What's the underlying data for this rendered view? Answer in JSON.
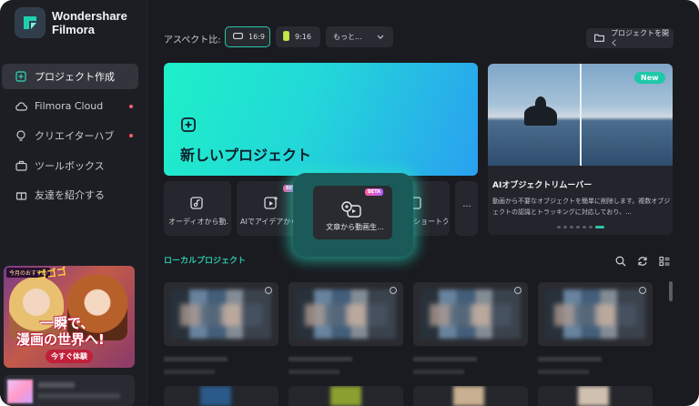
{
  "app": {
    "brand_line1": "Wondershare",
    "brand_line2": "Filmora"
  },
  "sidebar": {
    "items": [
      {
        "label": "プロジェクト作成",
        "icon": "plus-square-icon",
        "active": true,
        "dot": false
      },
      {
        "label": "Filmora Cloud",
        "icon": "cloud-icon",
        "active": false,
        "dot": true
      },
      {
        "label": "クリエイターハブ",
        "icon": "lightbulb-icon",
        "active": false,
        "dot": true
      },
      {
        "label": "ツールボックス",
        "icon": "toolbox-icon",
        "active": false,
        "dot": false
      },
      {
        "label": "友達を紹介する",
        "icon": "gift-icon",
        "active": false,
        "dot": false
      }
    ],
    "promo": {
      "tag": "今月のおすすめ",
      "headline_top": "ゴゴゴ",
      "headline_1": "一瞬で、",
      "headline_2": "漫画の世界へ!",
      "cta": "今すぐ体験"
    }
  },
  "toolbar": {
    "aspect_label": "アスペクト比:",
    "ratios": [
      {
        "label": "16:9",
        "selected": true
      },
      {
        "label": "9:16",
        "selected": false
      }
    ],
    "more_label": "もっと...",
    "open_project": "プロジェクトを開く"
  },
  "hero": {
    "label": "新しいプロジェクト"
  },
  "feature": {
    "badge": "New",
    "title": "AIオブジェクトリムーバー",
    "description": "動画から不要なオブジェクトを簡単に削除します。複数オブジェクトの認識とトラッキングに対応しており、..."
  },
  "tools": [
    {
      "label": "オーディオから動...",
      "icon": "audio-to-video-icon"
    },
    {
      "label": "AIでアイデアから...",
      "icon": "idea-to-video-icon",
      "beta": "BETA"
    },
    {
      "label": "文章から動画生...",
      "icon": "text-to-video-icon",
      "beta": "BETA",
      "highlighted": true
    },
    {
      "label": "ショートク...",
      "icon": "short-clip-icon"
    },
    {
      "label": "...",
      "icon": "more-icon"
    }
  ],
  "local_projects": {
    "title": "ローカルプロジェクト"
  },
  "colors": {
    "accent": "#2ec4a8",
    "background": "#1a1b20",
    "sidebar": "#1d1e24",
    "hero_start": "#1ef0c8",
    "hero_end": "#2aa0f0"
  }
}
